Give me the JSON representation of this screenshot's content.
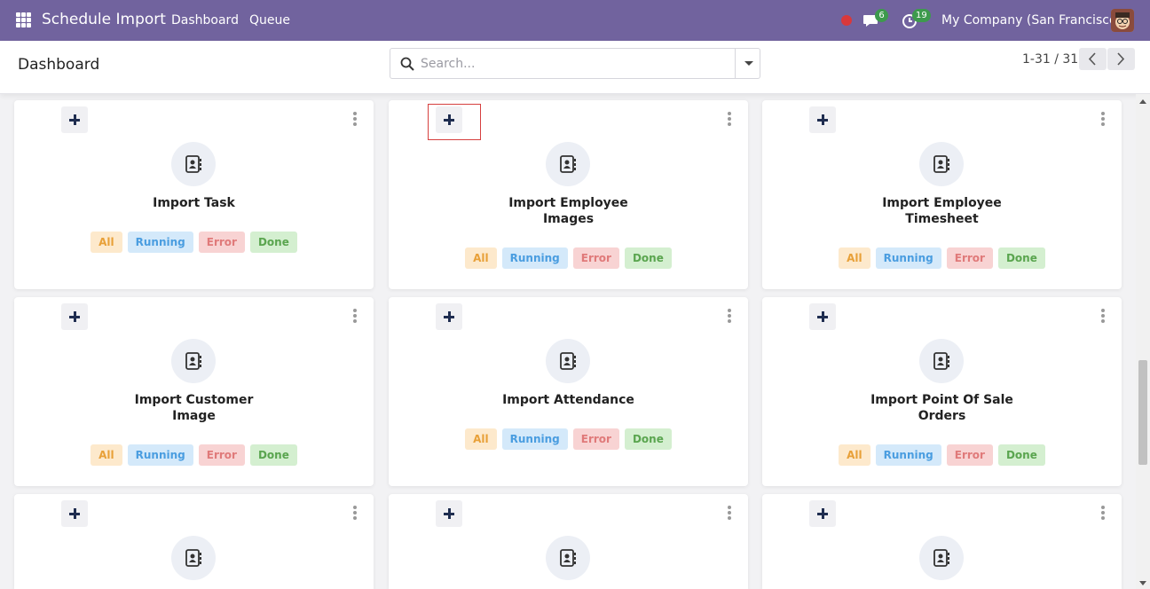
{
  "navbar": {
    "app_title": "Schedule Import",
    "links": [
      "Dashboard",
      "Queue"
    ],
    "messages_badge": "6",
    "activities_badge": "19",
    "company": "My Company (San Francisco)"
  },
  "control_panel": {
    "title": "Dashboard",
    "search_placeholder": "Search...",
    "pager": "1-31 / 31"
  },
  "status_labels": {
    "all": "All",
    "running": "Running",
    "error": "Error",
    "done": "Done"
  },
  "cards": [
    {
      "title_lines": [
        "Import Task"
      ]
    },
    {
      "title_lines": [
        "Import Employee",
        "Images"
      ]
    },
    {
      "title_lines": [
        "Import Employee",
        "Timesheet"
      ]
    },
    {
      "title_lines": [
        "Import Customer",
        "Image"
      ]
    },
    {
      "title_lines": [
        "Import Attendance"
      ]
    },
    {
      "title_lines": [
        "Import Point Of Sale",
        "Orders"
      ]
    },
    {
      "title_lines": []
    },
    {
      "title_lines": []
    },
    {
      "title_lines": []
    }
  ],
  "colors": {
    "navbar": "#71639e",
    "badge": "#3d9a4d",
    "record_dot": "#d9383b",
    "highlight": "#d6403f"
  }
}
